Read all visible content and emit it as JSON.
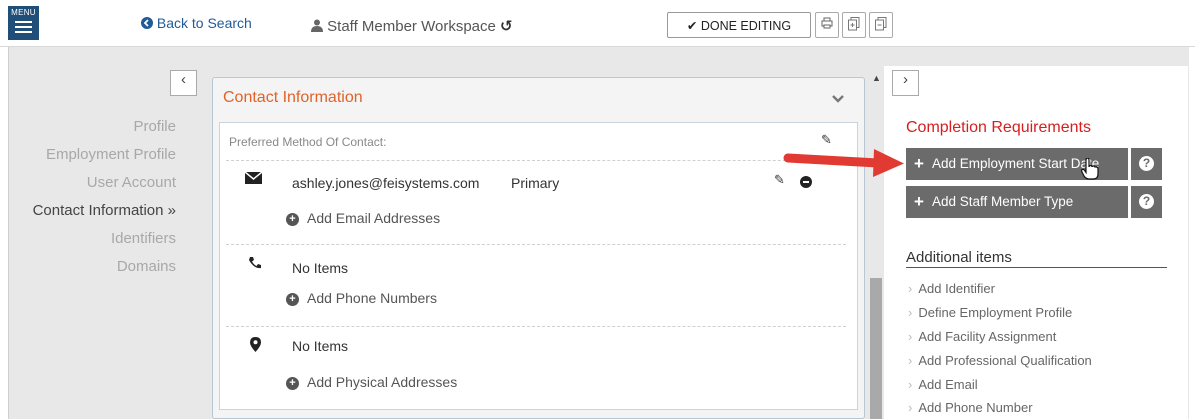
{
  "header": {
    "menu_label": "MENU",
    "back_label": "Back to Search",
    "workspace_title": "Staff Member Workspace",
    "done_label": "DONE EDITING"
  },
  "nav": {
    "items": [
      {
        "label": "Profile"
      },
      {
        "label": "Employment Profile"
      },
      {
        "label": "User Account"
      },
      {
        "label": "Contact Information »"
      },
      {
        "label": "Identifiers"
      },
      {
        "label": "Domains"
      }
    ],
    "active_index": 3
  },
  "contact_panel": {
    "title": "Contact Information",
    "preferred_label": "Preferred Method Of Contact:",
    "email": {
      "value": "ashley.jones@feisystems.com",
      "tag": "Primary",
      "add_label": "Add Email Addresses"
    },
    "phone": {
      "value": "No Items",
      "add_label": "Add Phone Numbers"
    },
    "address": {
      "value": "No Items",
      "add_label": "Add Physical Addresses"
    }
  },
  "completion": {
    "title": "Completion Requirements",
    "buttons": [
      {
        "label": "Add Employment Start Date"
      },
      {
        "label": "Add Staff Member Type"
      }
    ]
  },
  "additional": {
    "title": "Additional items",
    "items": [
      {
        "label": "Add Identifier"
      },
      {
        "label": "Define Employment Profile"
      },
      {
        "label": "Add Facility Assignment"
      },
      {
        "label": "Add Professional Qualification"
      },
      {
        "label": "Add Email"
      },
      {
        "label": "Add Phone Number"
      }
    ]
  },
  "colors": {
    "menu_bg": "#1f4e79",
    "link": "#1f5b97",
    "panel_title": "#e0632a",
    "completion_title": "#d61f1f",
    "req_button": "#6b6b6b",
    "arrow": "#e03a32"
  },
  "icons": [
    "menu-icon",
    "back-circle-icon",
    "user-icon",
    "history-icon",
    "check-icon",
    "print-icon",
    "expand-icon",
    "collapse-icon",
    "chevron-left-icon",
    "chevron-right-icon",
    "chevron-down-icon",
    "pencil-icon",
    "envelope-icon",
    "phone-icon",
    "map-marker-icon",
    "minus-circle-icon",
    "plus-circle-icon",
    "question-icon",
    "hand-cursor-icon",
    "red-arrow-icon"
  ]
}
